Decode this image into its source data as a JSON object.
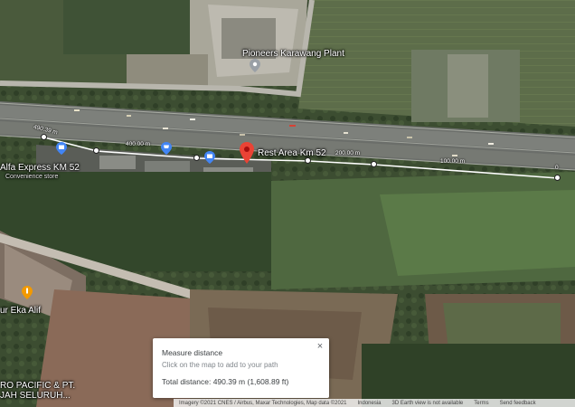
{
  "places": {
    "pioneers": "Pioneers Karawang Plant",
    "rest_area": "Rest Area Km 52",
    "alfa_express": "Alfa Express KM 52",
    "alfa_express_category": "Convenience store",
    "eka_alif": "ur Eka Alif",
    "pacific_line1": "RO PACIFIC & PT.",
    "pacific_line2": "JAH SELURUH..."
  },
  "distance_labels": {
    "d490": "490.39 m",
    "d400": "400.00 m",
    "d200": "200.00 m",
    "d100": "100.00 m",
    "d0": "0"
  },
  "measure": {
    "title": "Measure distance",
    "hint": "Click on the map to add to your path",
    "total": "Total distance: 490.39 m (1,608.89 ft)",
    "close_glyph": "×"
  },
  "footer": {
    "imagery": "Imagery ©2021 CNES / Airbus, Maxar Technologies, Map data ©2021",
    "country": "Indonesia",
    "earth_view": "3D Earth view is not available",
    "terms": "Terms",
    "feedback": "Send feedback"
  },
  "icons": {
    "place_pin": "grey-place-pin-icon",
    "shop_pin": "blue-cart-pin-icon",
    "store_pin": "blue-store-pin-icon",
    "red_pin": "red-location-pin-icon",
    "food_pin": "orange-food-pin-icon"
  },
  "colors": {
    "measure_line": "#ffffff",
    "red_pin": "#ea4335",
    "blue_pin": "#4285f4",
    "orange_pin": "#f29900"
  }
}
